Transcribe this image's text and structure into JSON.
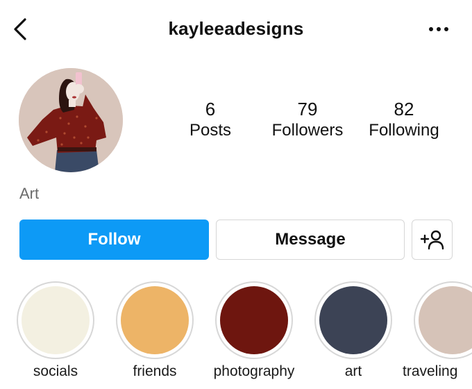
{
  "header": {
    "username": "kayleeadesigns",
    "back_icon": "chevron-left-icon",
    "more_icon": "more-horizontal-icon"
  },
  "profile": {
    "bio": "Art",
    "stats": [
      {
        "value": "6",
        "label": "Posts"
      },
      {
        "value": "79",
        "label": "Followers"
      },
      {
        "value": "82",
        "label": "Following"
      }
    ]
  },
  "actions": {
    "follow_label": "Follow",
    "message_label": "Message",
    "add_user_icon": "add-user-icon",
    "follow_color": "#0d9af6"
  },
  "highlights": [
    {
      "label": "socials",
      "color": "#f3f0e1"
    },
    {
      "label": "friends",
      "color": "#edb467"
    },
    {
      "label": "photography",
      "color": "#6e160f"
    },
    {
      "label": "art",
      "color": "#3c4355"
    },
    {
      "label": "traveling",
      "color": "#d6c3b8"
    }
  ]
}
